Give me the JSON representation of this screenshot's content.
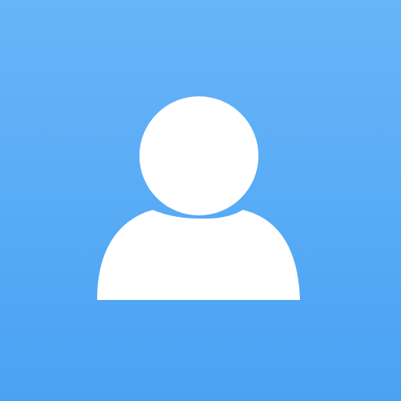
{
  "avatar": {
    "icon": "person-icon",
    "background_top": "#67B5F8",
    "background_bottom": "#4AA2F3",
    "figure_color": "#FFFFFF"
  }
}
